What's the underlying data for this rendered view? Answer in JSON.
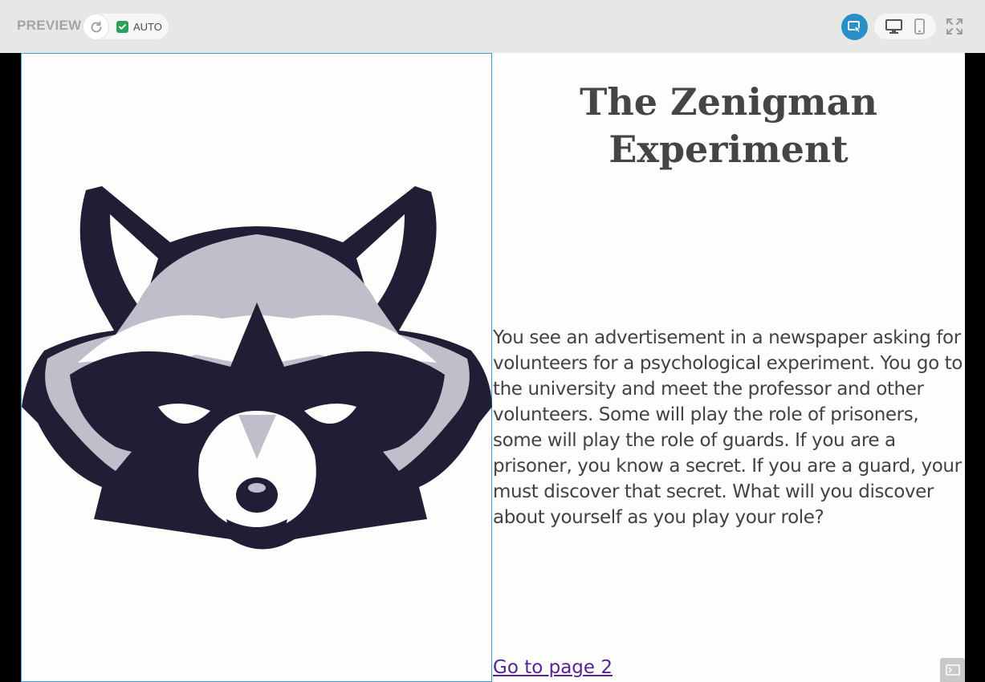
{
  "toolbar": {
    "preview_label": "PREVIEW",
    "auto_label": "AUTO",
    "auto_checked": true,
    "icons": {
      "refresh": "refresh-icon",
      "inspect": "inspect-cursor-icon",
      "desktop": "desktop-icon",
      "mobile": "mobile-icon",
      "fullscreen": "fullscreen-icon",
      "console": "console-icon"
    },
    "accent_color": "#2a8fc9"
  },
  "page": {
    "title": "The Zenigman Experiment",
    "story": "You see an advertisement in a newspaper asking for volunteers for a psychological experiment. You go to the university and meet the professor and other volunteers. Some will play the role of prisoners, some will play the role of guards. If you are a prisoner, you know a secret. If you are a guard, your must discover that secret. What will you discover about yourself as you play your role?",
    "next_link": "Go to page 2",
    "image": "raccoon-head-logo",
    "link_color": "#56239b"
  }
}
